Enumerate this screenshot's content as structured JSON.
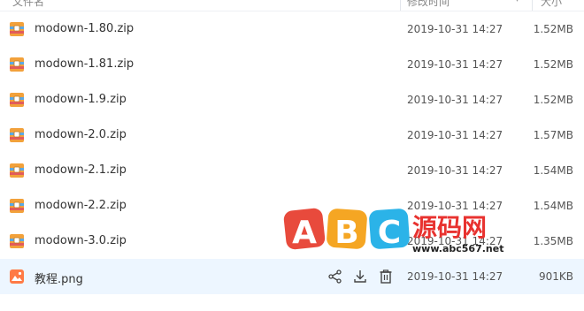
{
  "header": {
    "name_label": "文件名",
    "date_label": "修改时间",
    "size_label": "大小"
  },
  "files": [
    {
      "name": "modown-1.80.zip",
      "date": "2019-10-31 14:27",
      "size": "1.52MB",
      "icon": "archive-icon"
    },
    {
      "name": "modown-1.81.zip",
      "date": "2019-10-31 14:27",
      "size": "1.52MB",
      "icon": "archive-icon"
    },
    {
      "name": "modown-1.9.zip",
      "date": "2019-10-31 14:27",
      "size": "1.52MB",
      "icon": "archive-icon"
    },
    {
      "name": "modown-2.0.zip",
      "date": "2019-10-31 14:27",
      "size": "1.57MB",
      "icon": "archive-icon"
    },
    {
      "name": "modown-2.1.zip",
      "date": "2019-10-31 14:27",
      "size": "1.54MB",
      "icon": "archive-icon"
    },
    {
      "name": "modown-2.2.zip",
      "date": "2019-10-31 14:27",
      "size": "1.54MB",
      "icon": "archive-icon"
    },
    {
      "name": "modown-3.0.zip",
      "date": "2019-10-31 14:27",
      "size": "1.35MB",
      "icon": "archive-icon"
    },
    {
      "name": "教程.png",
      "date": "2019-10-31 14:27",
      "size": "901KB",
      "icon": "image-icon"
    }
  ],
  "row_actions": [
    "share-icon",
    "download-icon",
    "delete-icon"
  ],
  "watermark": {
    "letters": [
      "A",
      "B",
      "C"
    ],
    "text": "源码网",
    "url": "www.abc567.net"
  },
  "colors": {
    "selected_row": "#edf6ff",
    "archive_icon": "#f2a13b",
    "image_icon": "#ff7a45",
    "watermark_a": "#e84a3c",
    "watermark_b": "#f5a623",
    "watermark_c": "#2bb3e8",
    "watermark_text": "#e8322f"
  }
}
